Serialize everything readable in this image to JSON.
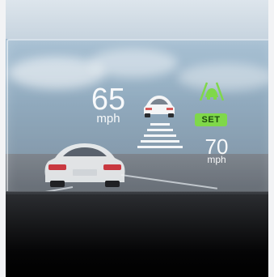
{
  "hud": {
    "current_speed": "65",
    "current_speed_unit": "mph",
    "set_label": "SET",
    "set_speed": "70",
    "set_speed_unit": "mph"
  },
  "icons": {
    "lane_assist": "lane-assist-icon",
    "lead_vehicle": "lead-vehicle-icon",
    "following_distance": "following-distance-bars"
  },
  "colors": {
    "hud_text": "#ffffff",
    "set_badge": "#7fd84a",
    "lane_icon": "#7fd84a"
  }
}
